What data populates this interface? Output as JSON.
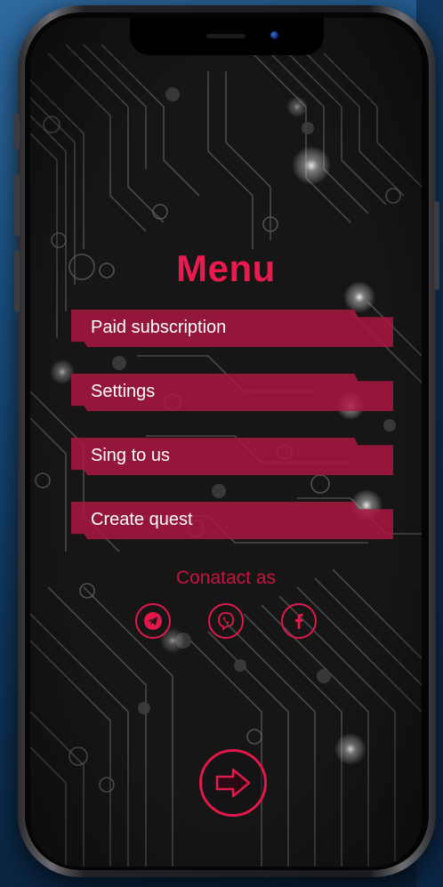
{
  "screen": {
    "title": "Menu",
    "menu_items": [
      {
        "label": "Paid subscription"
      },
      {
        "label": "Settings"
      },
      {
        "label": "Sing to us"
      },
      {
        "label": "Create quest"
      }
    ],
    "contact_label": "Conatact as",
    "social_icons": [
      "telegram-icon",
      "viber-icon",
      "facebook-icon"
    ],
    "next_icon": "arrow-right-icon"
  },
  "colors": {
    "accent": "#ea1a4f",
    "menu_item_bg": "#ab1642",
    "screen_bg": "#141415",
    "backdrop": "#194e7e"
  }
}
